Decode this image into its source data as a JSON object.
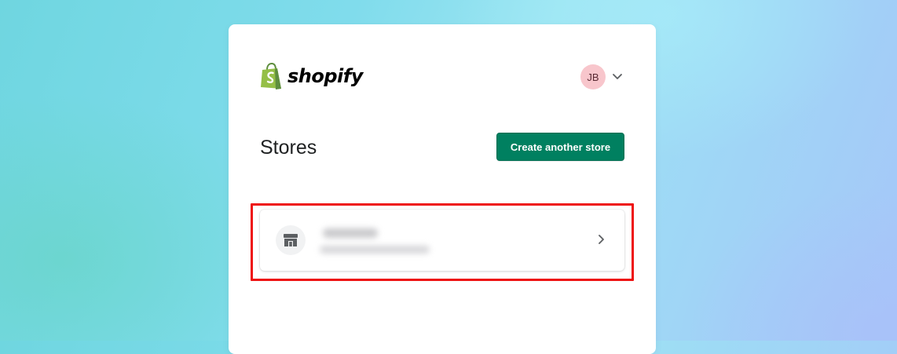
{
  "brand": {
    "name": "shopify",
    "logo_color": "#95bf47",
    "logo_shade": "#5e8e3e"
  },
  "user": {
    "initials": "JB",
    "avatar_color": "#f8c6cc"
  },
  "page": {
    "title": "Stores"
  },
  "actions": {
    "create_label": "Create another store",
    "accent": "#008060"
  },
  "stores": [
    {
      "icon": "store-icon",
      "name": "",
      "url": "",
      "name_blurred": true
    }
  ],
  "annotation": {
    "highlight_color": "#ee1111"
  }
}
